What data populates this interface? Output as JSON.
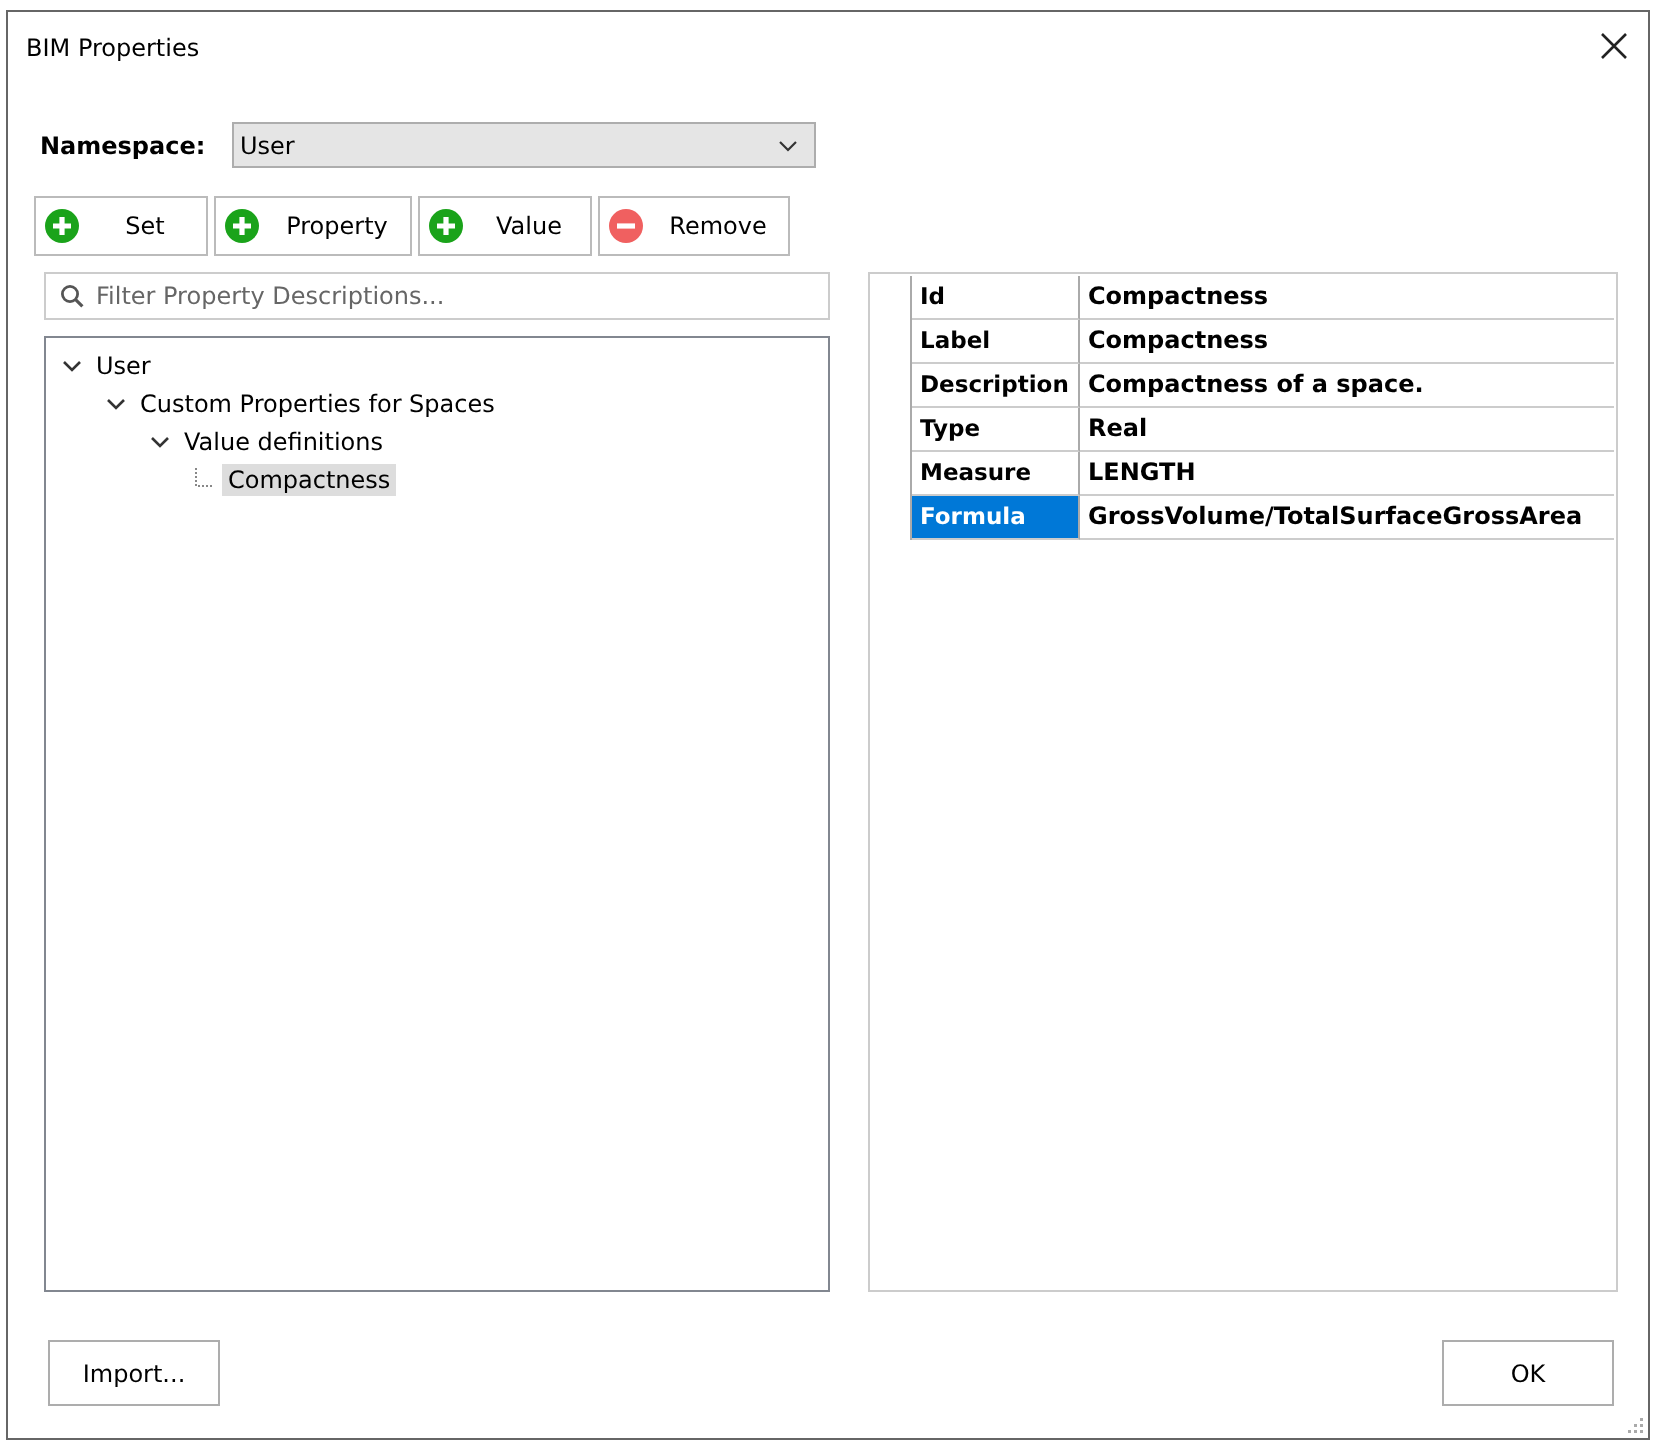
{
  "window": {
    "title": "BIM Properties"
  },
  "namespace": {
    "label": "Namespace:",
    "value": "User"
  },
  "toolbar": [
    {
      "label": "Set",
      "kind": "add"
    },
    {
      "label": "Property",
      "kind": "add"
    },
    {
      "label": "Value",
      "kind": "add"
    },
    {
      "label": "Remove",
      "kind": "remove"
    }
  ],
  "filter": {
    "placeholder": "Filter Property Descriptions..."
  },
  "tree": [
    {
      "label": "User",
      "expanded": true,
      "selected": false,
      "children": [
        {
          "label": "Custom Properties for Spaces",
          "expanded": true,
          "selected": false,
          "children": [
            {
              "label": "Value definitions",
              "expanded": true,
              "selected": false,
              "children": [
                {
                  "label": "Compactness",
                  "selected": true
                }
              ]
            }
          ]
        }
      ]
    }
  ],
  "properties": [
    {
      "name": "Id",
      "value": "Compactness",
      "selected": false
    },
    {
      "name": "Label",
      "value": "Compactness",
      "selected": false
    },
    {
      "name": "Description",
      "value": "Compactness of a space.",
      "selected": false
    },
    {
      "name": "Type",
      "value": "Real",
      "selected": false
    },
    {
      "name": "Measure",
      "value": "LENGTH",
      "selected": false
    },
    {
      "name": "Formula",
      "value": "GrossVolume/TotalSurfaceGrossArea",
      "selected": true
    }
  ],
  "buttons": {
    "left": "Import...",
    "right": "OK"
  }
}
